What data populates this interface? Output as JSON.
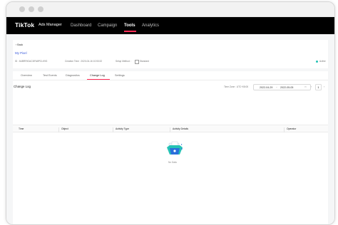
{
  "browser": {
    "dots": [
      "#cfcfcf",
      "#cfcfcf",
      "#cfcfcf"
    ]
  },
  "app": {
    "logo": "TikTok",
    "logo_sub": "Ads Manager",
    "nav": [
      {
        "label": "Dashboard",
        "active": false
      },
      {
        "label": "Campaign",
        "active": false
      },
      {
        "label": "Tools",
        "active": true
      },
      {
        "label": "Analytics",
        "active": false
      }
    ],
    "accent": "#fe2c55"
  },
  "pixel": {
    "back_label": "Back",
    "name": "My Pixel",
    "id_text": "ID : 6UBRRIGAC3IFA8PCLK9G",
    "creation_time": "Creation Time : 2020-04-16 10:53:32",
    "setup_method_label": "Setup Method :",
    "setup_method_value": "Standard",
    "status": "Active",
    "status_color": "#25c2b5"
  },
  "tabs": [
    {
      "label": "Overview",
      "active": false
    },
    {
      "label": "Test Events",
      "active": false
    },
    {
      "label": "Diagnostics",
      "active": false
    },
    {
      "label": "Change Log",
      "active": true
    },
    {
      "label": "Settings",
      "active": false
    }
  ],
  "change_log": {
    "title": "Change Log",
    "time_zone": "Time Zone : UTC+08:00",
    "date_start": "2022-04-29",
    "date_sep": "~",
    "date_end": "2022-05-05",
    "page": "1",
    "columns": [
      "Time",
      "Object",
      "Activity Type",
      "Activity Details",
      "Operator"
    ],
    "empty_text": "No Data"
  }
}
